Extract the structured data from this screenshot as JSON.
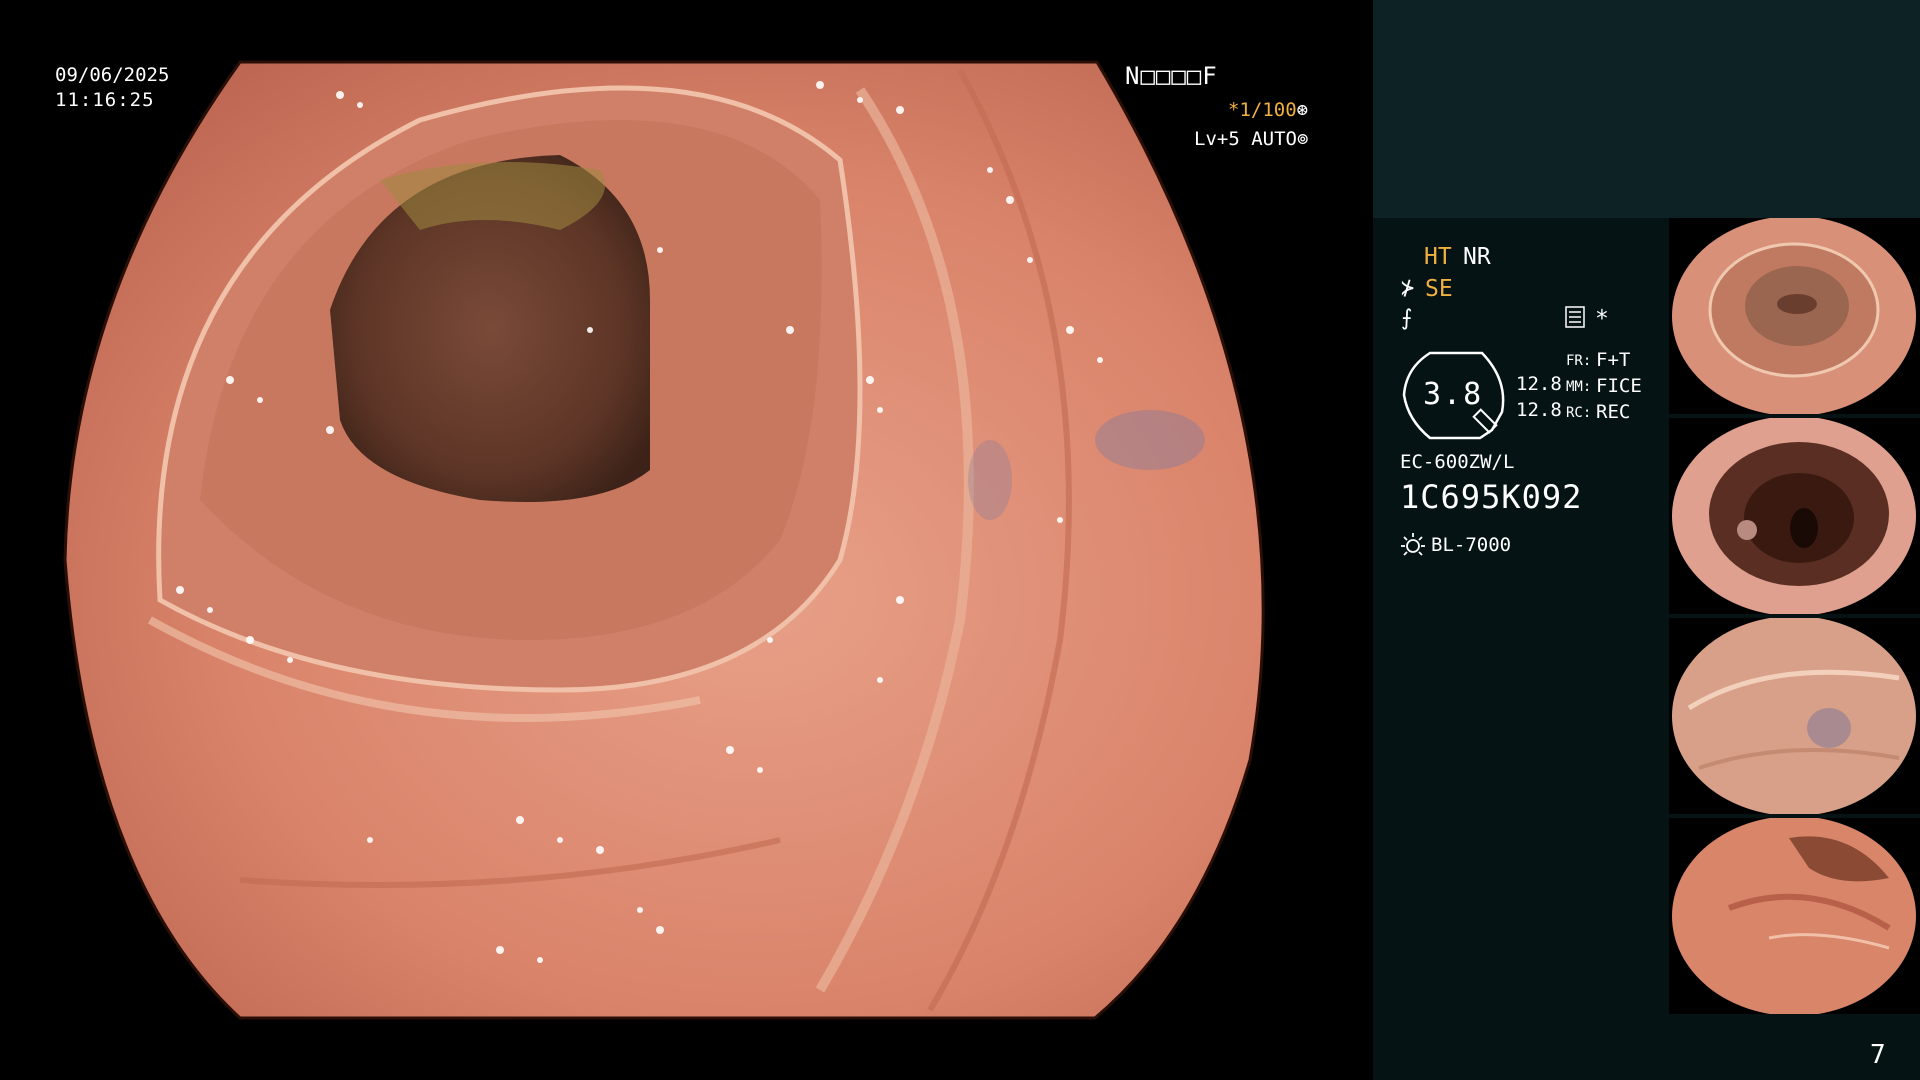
{
  "overlay": {
    "date": "09/06/2025",
    "time": "11:16:25",
    "patient_id": "N□□□□F",
    "shutter": "*1/100",
    "level": "Lv+5 AUTO"
  },
  "panel": {
    "ht": "HT",
    "nr": "NR",
    "se": "SE",
    "star": "*",
    "dial_value": "3.8",
    "val1": "12.8",
    "val2": "12.8",
    "fr_label": "FR:",
    "fr_value": "F+T",
    "mm_label": "MM:",
    "mm_value": "FICE",
    "rc_label": "RC:",
    "rc_value": "REC",
    "scope_model": "EC-600ZW/L",
    "scope_serial": "1C695K092",
    "light_source": "BL-7000",
    "page_number": "7"
  },
  "colors": {
    "panel_bg": "#061314",
    "top_band": "#0c2224",
    "amber": "#f0b040",
    "mucosa": "#d98a70"
  }
}
